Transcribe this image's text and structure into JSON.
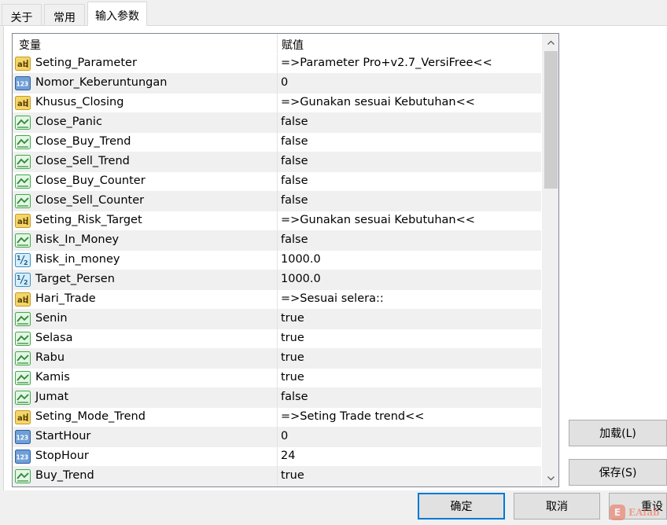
{
  "tabs": [
    {
      "label": "关于"
    },
    {
      "label": "常用"
    },
    {
      "label": "输入参数"
    }
  ],
  "grid": {
    "header_variable": "变量",
    "header_value": "赋值",
    "rows": [
      {
        "type": "string",
        "name": "Seting_Parameter",
        "value": "=>Parameter Pro+v2.7_VersiFree<<"
      },
      {
        "type": "int",
        "name": "Nomor_Keberuntungan",
        "value": "0"
      },
      {
        "type": "string",
        "name": "Khusus_Closing",
        "value": "=>Gunakan sesuai Kebutuhan<<"
      },
      {
        "type": "bool",
        "name": "Close_Panic",
        "value": "false"
      },
      {
        "type": "bool",
        "name": "Close_Buy_Trend",
        "value": "false"
      },
      {
        "type": "bool",
        "name": "Close_Sell_Trend",
        "value": "false"
      },
      {
        "type": "bool",
        "name": "Close_Buy_Counter",
        "value": "false"
      },
      {
        "type": "bool",
        "name": "Close_Sell_Counter",
        "value": "false"
      },
      {
        "type": "string",
        "name": "Seting_Risk_Target",
        "value": "=>Gunakan sesuai Kebutuhan<<"
      },
      {
        "type": "bool",
        "name": "Risk_In_Money",
        "value": "false"
      },
      {
        "type": "double",
        "name": "Risk_in_money",
        "value": "1000.0"
      },
      {
        "type": "double",
        "name": "Target_Persen",
        "value": "1000.0"
      },
      {
        "type": "string",
        "name": "Hari_Trade",
        "value": "=>Sesuai selera::"
      },
      {
        "type": "bool",
        "name": "Senin",
        "value": "true"
      },
      {
        "type": "bool",
        "name": "Selasa",
        "value": "true"
      },
      {
        "type": "bool",
        "name": "Rabu",
        "value": "true"
      },
      {
        "type": "bool",
        "name": "Kamis",
        "value": "true"
      },
      {
        "type": "bool",
        "name": "Jumat",
        "value": "false"
      },
      {
        "type": "string",
        "name": "Seting_Mode_Trend",
        "value": "=>Seting Trade trend<<"
      },
      {
        "type": "int",
        "name": "StartHour",
        "value": "0"
      },
      {
        "type": "int",
        "name": "StopHour",
        "value": "24"
      },
      {
        "type": "bool",
        "name": "Buy_Trend",
        "value": "true"
      }
    ]
  },
  "icons": {
    "string": "ab-string-icon",
    "int": "123-integer-icon",
    "bool": "bool-chart-icon",
    "double": "half-double-icon"
  },
  "buttons": {
    "load": "加载(L)",
    "save": "保存(S)",
    "ok": "确定",
    "cancel": "取消",
    "reset": "重设"
  },
  "watermark": {
    "badge": "E",
    "text": "EAfab"
  },
  "colors": {
    "string_icon": "#e8c24a",
    "int_icon": "#4a7fc1",
    "bool_icon": "#3faa4a",
    "double_icon": "#52a8d8",
    "primary_border": "#0078d7"
  }
}
